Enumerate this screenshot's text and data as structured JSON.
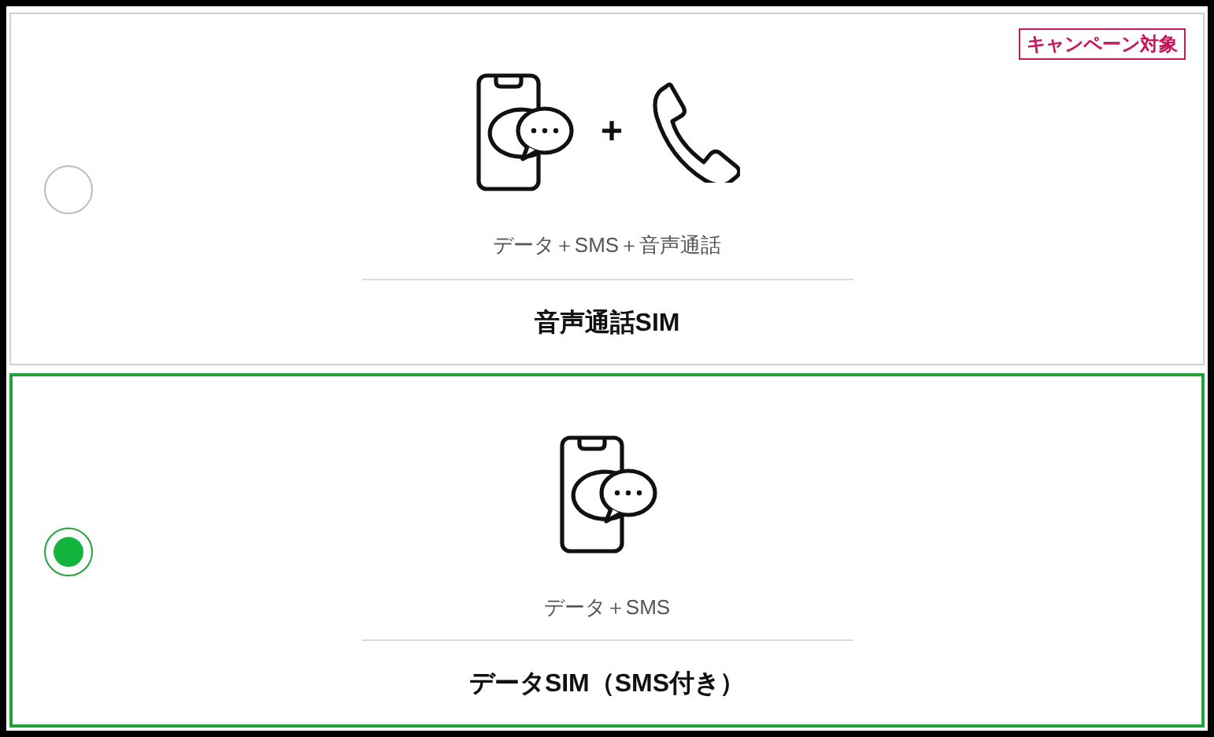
{
  "options": [
    {
      "selected": false,
      "badge": "キャンペーン対象",
      "icons": [
        {
          "kind": "phone"
        },
        {
          "kind": "plus",
          "text": "+"
        },
        {
          "kind": "handset"
        }
      ],
      "description": "データ＋SMS＋音声通話",
      "title": "音声通話SIM"
    },
    {
      "selected": true,
      "icons": [
        {
          "kind": "phone"
        }
      ],
      "description": "データ＋SMS",
      "title": "データSIM（SMS付き）"
    }
  ]
}
